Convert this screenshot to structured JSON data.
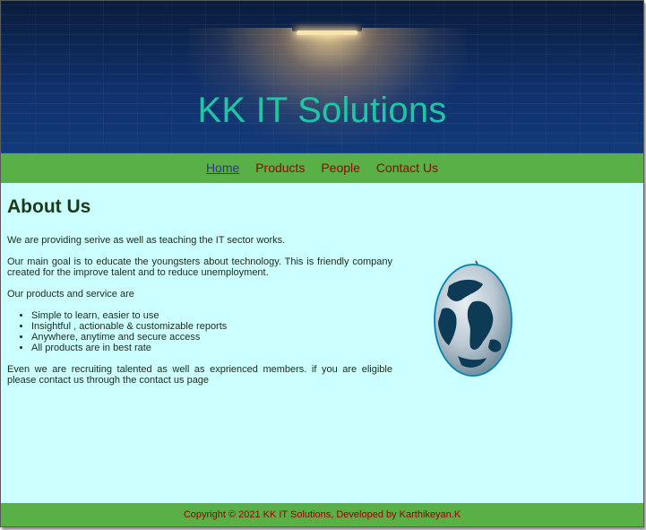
{
  "header": {
    "title": "KK IT Solutions"
  },
  "nav": {
    "items": [
      "Home",
      "Products",
      "People",
      "Contact Us"
    ]
  },
  "about": {
    "heading": "About Us",
    "p1": "We are providing serive as well as teaching the IT sector works.",
    "p2": "Our main goal is to educate the youngsters about technology. This is friendly company created for the improve talent and to reduce unemployment.",
    "p3": "Our products and service are",
    "bullets": [
      "Simple to learn, easier to use",
      "Insightful , actionable & customizable reports",
      "Anywhere, anytime and secure access",
      "All products are in best rate"
    ],
    "p4": "Even we are recruiting talented as well as exprienced members. if you are eligible please contact us through the contact us page"
  },
  "footer": {
    "text": "Copyright © 2021 KK IT Solutions, Developed by Karthikeyan.K"
  },
  "colors": {
    "nav_bg": "#58b047",
    "content_bg": "#ccffff",
    "title_color": "#1ec6a4",
    "link_color": "#990000",
    "active_link_color": "#333399"
  }
}
